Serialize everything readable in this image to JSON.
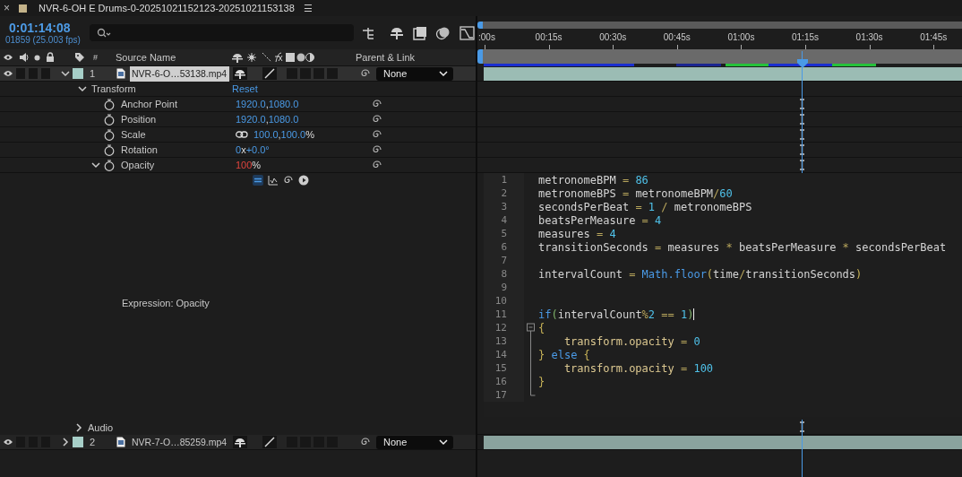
{
  "panel": {
    "close": "×",
    "title": "NVR-6-OH E Drums-0-20251021152123-20251021153138",
    "menu": "☰"
  },
  "timecode": "0:01:14:08",
  "frame_info": "01859 (25.003 fps)",
  "columns": {
    "number": "#",
    "source_name": "Source Name",
    "parent": "Parent & Link"
  },
  "ruler": [
    ":00s",
    "00:15s",
    "00:30s",
    "00:45s",
    "01:00s",
    "01:15s",
    "01:30s",
    "01:45s"
  ],
  "layers": [
    {
      "number": "1",
      "name": "NVR-6-O…53138.mp4",
      "selected": true,
      "expanded": true,
      "color": "#a7cfc8",
      "parent": "None"
    }
  ],
  "transform": {
    "label": "Transform",
    "expanded": true,
    "reset": "Reset",
    "properties": [
      {
        "name": "Anchor Point",
        "linked": false,
        "expanded": false,
        "value": [
          {
            "kind": "value",
            "text": "1920.0"
          },
          {
            "kind": "sep",
            "text": ","
          },
          {
            "kind": "value",
            "text": "1080.0"
          }
        ]
      },
      {
        "name": "Position",
        "linked": false,
        "expanded": false,
        "value": [
          {
            "kind": "value",
            "text": "1920.0"
          },
          {
            "kind": "sep",
            "text": ","
          },
          {
            "kind": "value",
            "text": "1080.0"
          }
        ]
      },
      {
        "name": "Scale",
        "linked": true,
        "expanded": false,
        "value": [
          {
            "kind": "value",
            "text": "100.0"
          },
          {
            "kind": "sep",
            "text": ","
          },
          {
            "kind": "value",
            "text": "100.0"
          },
          {
            "kind": "sep",
            "text": "%"
          }
        ]
      },
      {
        "name": "Rotation",
        "linked": false,
        "expanded": false,
        "value": [
          {
            "kind": "value",
            "text": "0"
          },
          {
            "kind": "sep",
            "text": "x"
          },
          {
            "kind": "value",
            "text": "+0.0°"
          }
        ]
      },
      {
        "name": "Opacity",
        "linked": false,
        "expanded": true,
        "value": [
          {
            "kind": "expr",
            "text": "100"
          },
          {
            "kind": "sep",
            "text": "%"
          }
        ]
      }
    ]
  },
  "expression_label": "Expression: Opacity",
  "code": [
    {
      "number": "1",
      "caret": false,
      "kind": "plain",
      "tokens": [
        {
          "kind": "ident",
          "text": "metronomeBPM"
        },
        {
          "kind": "op",
          "text": " = "
        },
        {
          "kind": "num",
          "text": "86"
        }
      ]
    },
    {
      "number": "2",
      "caret": false,
      "kind": "plain",
      "tokens": [
        {
          "kind": "ident",
          "text": "metronomeBPS"
        },
        {
          "kind": "op",
          "text": " = "
        },
        {
          "kind": "ident",
          "text": "metronomeBPM"
        },
        {
          "kind": "op",
          "text": "/"
        },
        {
          "kind": "num",
          "text": "60"
        }
      ]
    },
    {
      "number": "3",
      "caret": false,
      "kind": "plain",
      "tokens": [
        {
          "kind": "ident",
          "text": "secondsPerBeat"
        },
        {
          "kind": "op",
          "text": " = "
        },
        {
          "kind": "num",
          "text": "1"
        },
        {
          "kind": "op",
          "text": " / "
        },
        {
          "kind": "ident",
          "text": "metronomeBPS"
        }
      ]
    },
    {
      "number": "4",
      "caret": false,
      "kind": "plain",
      "tokens": [
        {
          "kind": "ident",
          "text": "beatsPerMeasure"
        },
        {
          "kind": "op",
          "text": " = "
        },
        {
          "kind": "num",
          "text": "4"
        }
      ]
    },
    {
      "number": "5",
      "caret": false,
      "kind": "plain",
      "tokens": [
        {
          "kind": "ident",
          "text": "measures"
        },
        {
          "kind": "op",
          "text": " = "
        },
        {
          "kind": "num",
          "text": "4"
        }
      ]
    },
    {
      "number": "6",
      "caret": false,
      "kind": "plain",
      "tokens": [
        {
          "kind": "ident",
          "text": "transitionSeconds"
        },
        {
          "kind": "op",
          "text": " = "
        },
        {
          "kind": "ident",
          "text": "measures"
        },
        {
          "kind": "op",
          "text": " * "
        },
        {
          "kind": "ident",
          "text": "beatsPerMeasure"
        },
        {
          "kind": "op",
          "text": " * "
        },
        {
          "kind": "ident",
          "text": "secondsPerBeat"
        }
      ]
    },
    {
      "number": "7",
      "caret": false,
      "kind": "plain"
    },
    {
      "number": "8",
      "caret": false,
      "kind": "plain",
      "tokens": [
        {
          "kind": "ident",
          "text": "intervalCount"
        },
        {
          "kind": "op",
          "text": " = "
        },
        {
          "kind": "func",
          "text": "Math.floor"
        },
        {
          "kind": "paren",
          "text": "("
        },
        {
          "kind": "ident",
          "text": "time"
        },
        {
          "kind": "op",
          "text": "/"
        },
        {
          "kind": "ident",
          "text": "transitionSeconds"
        },
        {
          "kind": "paren",
          "text": ")"
        }
      ]
    },
    {
      "number": "9",
      "caret": false,
      "kind": "plain"
    },
    {
      "number": "10",
      "caret": false,
      "kind": "plain"
    },
    {
      "number": "11",
      "caret": true,
      "kind": "plain",
      "tokens": [
        {
          "kind": "kw",
          "text": "if"
        },
        {
          "kind": "bracket",
          "text": "("
        },
        {
          "kind": "ident",
          "text": "intervalCount"
        },
        {
          "kind": "op",
          "text": "%"
        },
        {
          "kind": "num",
          "text": "2"
        },
        {
          "kind": "op",
          "text": " == "
        },
        {
          "kind": "num",
          "text": "1"
        },
        {
          "kind": "bracket",
          "text": ")"
        }
      ]
    },
    {
      "number": "12",
      "caret": false,
      "kind": "opener",
      "tokens": [
        {
          "kind": "paren",
          "text": "{"
        }
      ]
    },
    {
      "number": "13",
      "caret": false,
      "kind": "inner",
      "tokens": [
        {
          "kind": "prop",
          "text": "    transform.opacity"
        },
        {
          "kind": "op",
          "text": " = "
        },
        {
          "kind": "num",
          "text": "0"
        }
      ]
    },
    {
      "number": "14",
      "caret": false,
      "kind": "inner",
      "tokens": [
        {
          "kind": "paren",
          "text": "}"
        },
        {
          "kind": "kw",
          "text": " else"
        },
        {
          "kind": "paren",
          "text": " {"
        }
      ]
    },
    {
      "number": "15",
      "caret": false,
      "kind": "inner",
      "tokens": [
        {
          "kind": "prop",
          "text": "    transform.opacity"
        },
        {
          "kind": "op",
          "text": " = "
        },
        {
          "kind": "num",
          "text": "100"
        }
      ]
    },
    {
      "number": "16",
      "caret": false,
      "kind": "inner",
      "tokens": [
        {
          "kind": "paren",
          "text": "}"
        }
      ]
    },
    {
      "number": "17",
      "caret": false,
      "kind": "closer"
    }
  ],
  "audio": {
    "label": "Audio",
    "expanded": false
  },
  "layers_after": [
    {
      "number": "2",
      "name": "NVR-7-O…85259.mp4",
      "selected": false,
      "expanded": false,
      "color": "#a7cfc8",
      "parent": "None"
    }
  ]
}
